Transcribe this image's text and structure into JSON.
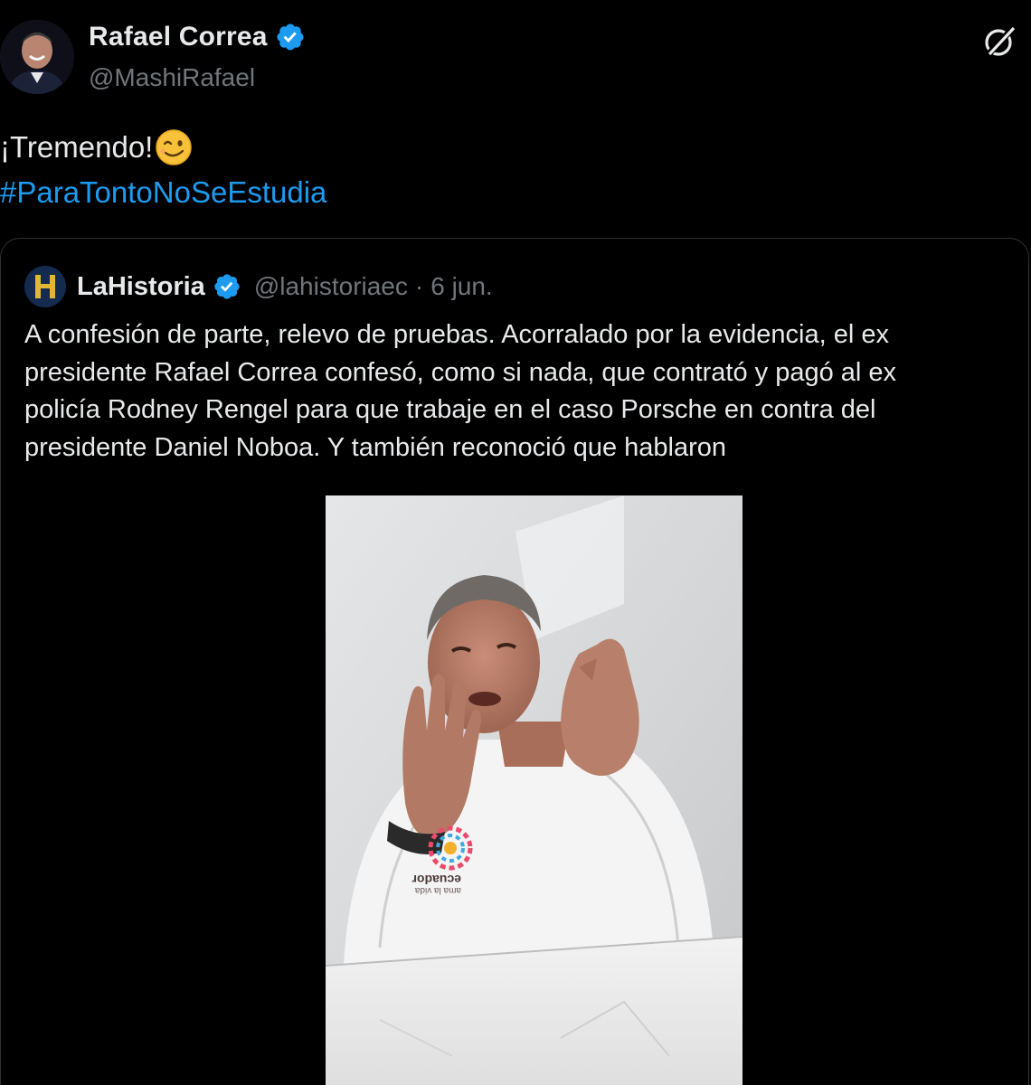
{
  "author": {
    "display_name": "Rafael Correa",
    "handle": "@MashiRafael",
    "verified": true,
    "avatar_icon": "profile-photo"
  },
  "header": {
    "grok_icon": "grok-icon"
  },
  "tweet": {
    "text_line1": "¡Tremendo!",
    "emoji": "winking-face",
    "hashtag": "#ParaTontoNoSeEstudia"
  },
  "quoted_tweet": {
    "display_name": "LaHistoria",
    "handle": "@lahistoriaec",
    "separator": "·",
    "date": "6 jun.",
    "verified": true,
    "avatar_letter": "H",
    "text_lines": [
      "A confesión de parte, relevo de pruebas. Acorralado por la evidencia, el ex",
      "presidente Rafael Correa confesó, como si nada, que contrató y pagó al ex",
      "policía Rodney Rengel para que trabaje en el caso Porsche en contra del",
      "presidente Daniel Noboa. Y también reconoció que hablaron"
    ],
    "media": {
      "type": "video-thumbnail",
      "shirt_logo_text": "ecuador",
      "shirt_logo_subtext": "ama la vida"
    }
  },
  "colors": {
    "background": "#000000",
    "text": "#e7e9ea",
    "secondary_text": "#71767b",
    "link": "#1d9bf0",
    "verified": "#1d9bf0",
    "border": "#2f3336"
  }
}
